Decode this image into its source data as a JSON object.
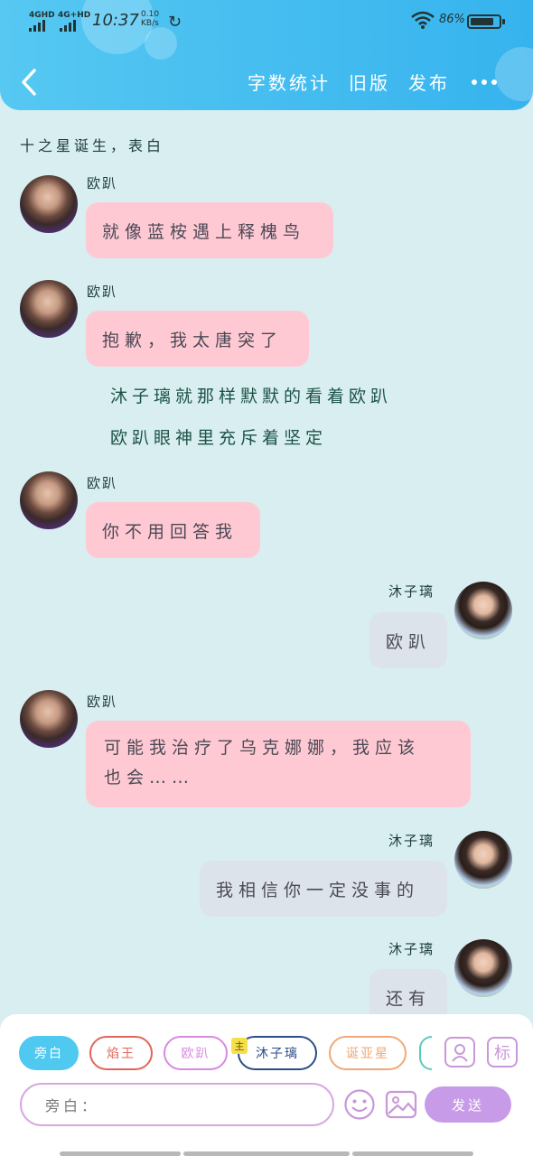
{
  "status_bar": {
    "sig1": "4GHD",
    "sig2": "4G+HD",
    "time": "10:37",
    "speed_value": "0.10",
    "speed_unit": "KB/s",
    "battery": "86%"
  },
  "nav": {
    "word_count": "字数统计",
    "old_version": "旧版",
    "publish": "发布"
  },
  "chat": {
    "topic": "十之星诞生，表白",
    "messages": [
      {
        "speaker": "欧趴",
        "text": "就像蓝桉遇上释槐鸟"
      },
      {
        "speaker": "欧趴",
        "text": "抱歉，我太唐突了"
      },
      {
        "narration_1": "沐子璃就那样默默的看着欧趴",
        "narration_2": "欧趴眼神里充斥着坚定"
      },
      {
        "speaker": "欧趴",
        "text": "你不用回答我"
      },
      {
        "speaker": "沐子璃",
        "text": "欧趴"
      },
      {
        "speaker": "欧趴",
        "text_line1": "可能我治疗了乌克娜娜，我应该",
        "text_line2": "也会……"
      },
      {
        "speaker": "沐子璃",
        "text": "我相信你一定没事的"
      },
      {
        "speaker": "沐子璃",
        "text": "还有"
      }
    ]
  },
  "composer": {
    "chips": [
      "旁白",
      "焰王",
      "欧趴",
      "沐子璃",
      "诞亚星"
    ],
    "badge": "主",
    "role_icon_2": "标",
    "placeholder": "旁白：",
    "send": "发送",
    "colors": {
      "accent": "#4fc9ef",
      "chip_yanwang": "#e0665a",
      "chip_oupa": "#d88adf",
      "chip_muzili": "#2c4e86",
      "chip_danyaxing": "#f0a87a",
      "send": "#c79be8"
    }
  }
}
